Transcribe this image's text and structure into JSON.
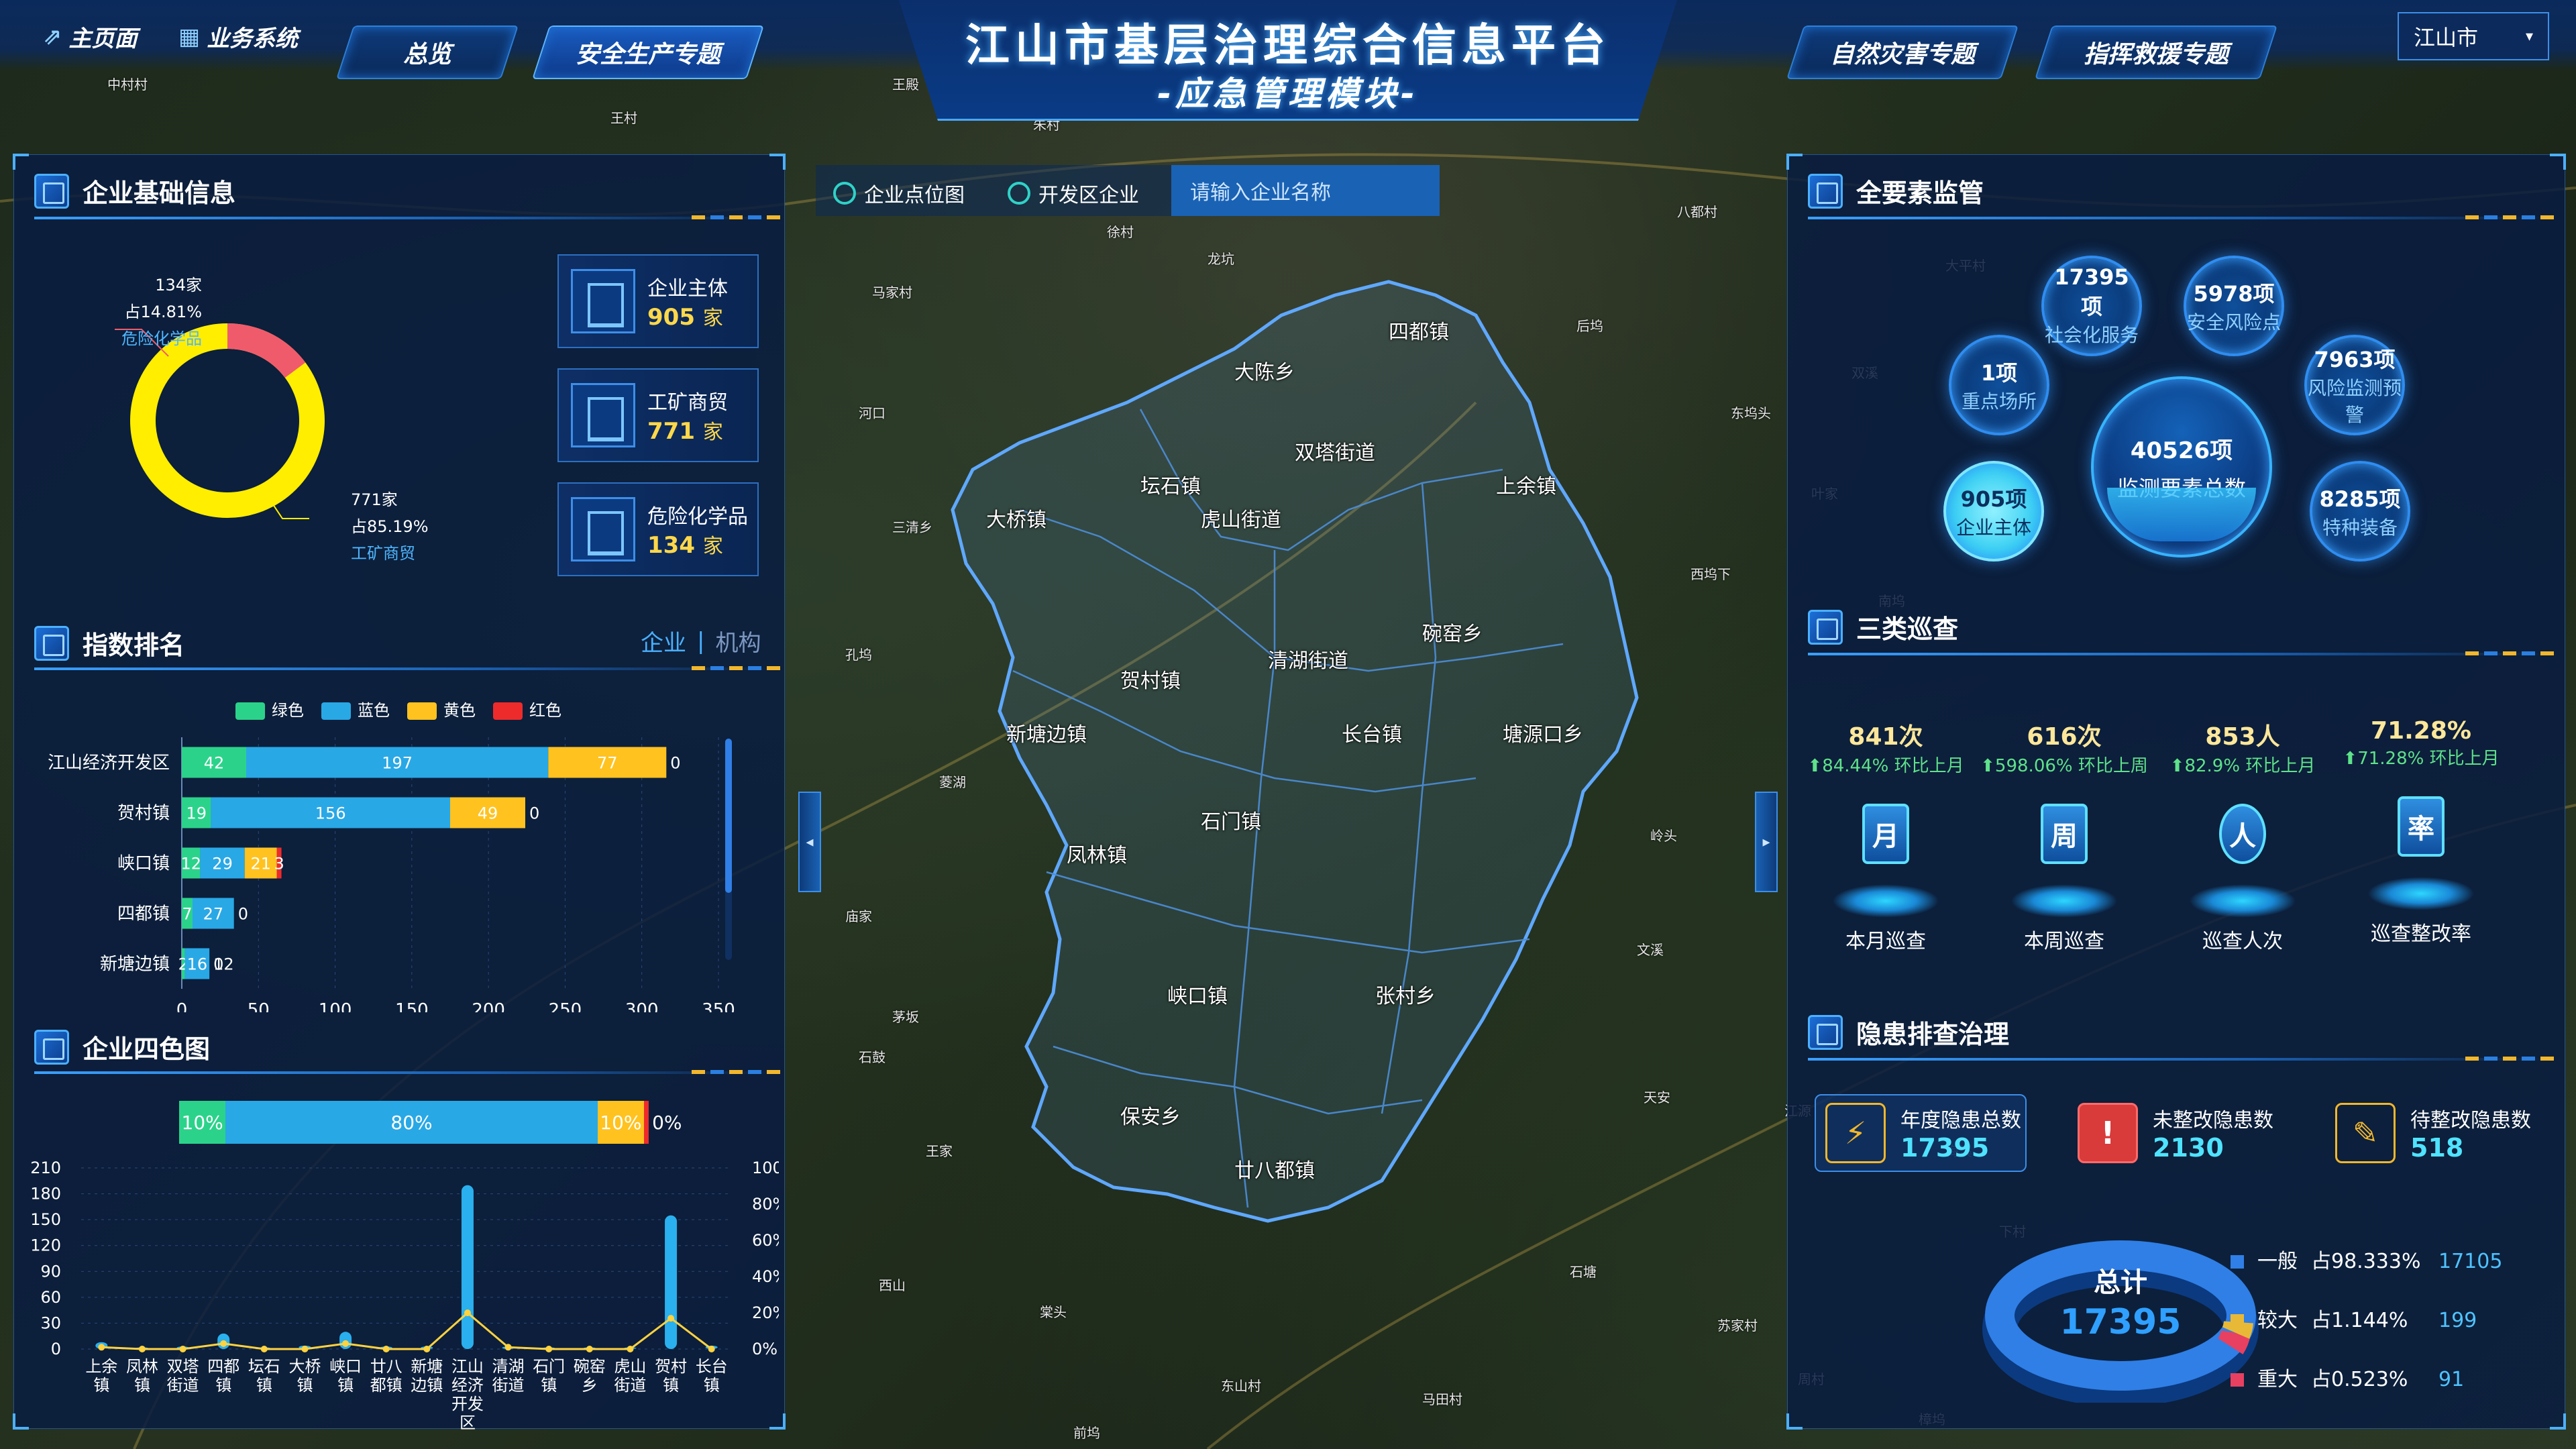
{
  "header": {
    "title": "江山市基层治理综合信息平台",
    "subtitle": "-应急管理模块-",
    "home_link": "主页面",
    "biz_link": "业务系统",
    "tabs": [
      "总览",
      "安全生产专题",
      "自然灾害专题",
      "指挥救援专题"
    ],
    "active_tab": "安全生产专题",
    "city_select": "江山市"
  },
  "map": {
    "toggle_point": "企业点位图",
    "toggle_zone": "开发区企业",
    "search_placeholder": "请输入企业名称",
    "townships": [
      "四都镇",
      "大陈乡",
      "双塔街道",
      "大桥镇",
      "坛石镇",
      "虎山街道",
      "上余镇",
      "碗窑乡",
      "贺村镇",
      "清湖街道",
      "新塘边镇",
      "长台镇",
      "塘源口乡",
      "凤林镇",
      "石门镇",
      "峡口镇",
      "张村乡",
      "保安乡",
      "廿八都镇"
    ],
    "villages": [
      "中村村",
      "王殿",
      "王村",
      "朱村",
      "龙坑",
      "马家村",
      "东坞头",
      "双溪",
      "八都村",
      "大平村",
      "三清乡",
      "孔坞",
      "西坞下",
      "南坞",
      "菱湖",
      "庙家",
      "王家",
      "天安",
      "石塘",
      "棠头",
      "苏家村",
      "东山村",
      "马田村",
      "周村",
      "西山",
      "石鼓",
      "文溪",
      "江源",
      "茅坂",
      "岭头",
      "梅溪",
      "下村",
      "前坞",
      "樟坞",
      "河口",
      "叶家",
      "徐村",
      "后坞"
    ]
  },
  "enterprise_info": {
    "title": "企业基础信息",
    "donut": [
      {
        "name": "危险化学品",
        "count": "134家",
        "pct": "占14.81%",
        "color": "#f05b6c"
      },
      {
        "name": "工矿商贸",
        "count": "771家",
        "pct": "占85.19%",
        "color": "#ffee00"
      }
    ],
    "cards": [
      {
        "label": "企业主体",
        "value": "905",
        "unit": "家"
      },
      {
        "label": "工矿商贸",
        "value": "771",
        "unit": "家"
      },
      {
        "label": "危险化学品",
        "value": "134",
        "unit": "家"
      }
    ]
  },
  "index_rank": {
    "title": "指数排名",
    "tab_enterprise": "企业",
    "tab_org": "机构",
    "legend": [
      {
        "name": "绿色",
        "color": "#2bd38a"
      },
      {
        "name": "蓝色",
        "color": "#29a8e6"
      },
      {
        "name": "黄色",
        "color": "#ffc21f"
      },
      {
        "name": "红色",
        "color": "#ee2b2b"
      }
    ]
  },
  "four_color": {
    "title": "企业四色图",
    "segments": [
      {
        "label": "10%",
        "pct": 10,
        "color": "#2bd38a"
      },
      {
        "label": "80%",
        "pct": 80,
        "color": "#29a8e6"
      },
      {
        "label": "10%",
        "pct": 10,
        "color": "#ffc21f"
      },
      {
        "label": "0%",
        "pct": 1,
        "color": "#ee2b2b"
      }
    ]
  },
  "chart_data": [
    {
      "type": "bar",
      "orientation": "horizontal",
      "stacked": true,
      "categories": [
        "江山经济开发区",
        "贺村镇",
        "峡口镇",
        "四都镇",
        "新塘边镇"
      ],
      "series": [
        {
          "name": "绿色",
          "values": [
            42,
            19,
            12,
            7,
            2
          ]
        },
        {
          "name": "蓝色",
          "values": [
            197,
            156,
            29,
            27,
            16
          ]
        },
        {
          "name": "黄色",
          "values": [
            77,
            49,
            21,
            0,
            0
          ]
        },
        {
          "name": "红色",
          "values": [
            0,
            0,
            3,
            0,
            0
          ]
        }
      ],
      "data_labels": [
        [
          "42",
          "197",
          "77",
          "0"
        ],
        [
          "19",
          "156",
          "49",
          "0"
        ],
        [
          "12",
          "29",
          "21",
          "3"
        ],
        [
          "7",
          "27",
          "0",
          ""
        ],
        [
          "2",
          "16",
          "12",
          "0"
        ]
      ],
      "xlim": [
        0,
        350
      ],
      "xticks": [
        0,
        50,
        100,
        150,
        200,
        250,
        300,
        350
      ]
    },
    {
      "type": "bar",
      "title": "",
      "categories": [
        "上余镇",
        "凤林镇",
        "双塔街道",
        "四都镇",
        "坛石镇",
        "大桥镇",
        "峡口镇",
        "廿八都镇",
        "新塘边镇",
        "江山经济开发区",
        "清湖街道",
        "石门镇",
        "碗窑乡",
        "虎山街道",
        "贺村镇",
        "长台镇"
      ],
      "series": [
        {
          "name": "数量",
          "type": "bar",
          "values": [
            8,
            2,
            3,
            18,
            2,
            4,
            20,
            3,
            3,
            190,
            3,
            2,
            2,
            2,
            155,
            4
          ]
        },
        {
          "name": "比例",
          "type": "line",
          "axis": "right",
          "values": [
            1,
            0,
            0,
            3,
            0,
            0,
            3,
            0,
            0,
            20,
            1,
            0,
            0,
            0,
            17,
            0
          ]
        }
      ],
      "ylim": [
        0,
        210
      ],
      "yticks": [
        0,
        30,
        60,
        90,
        120,
        150,
        180,
        210
      ],
      "y2lim": [
        0,
        100
      ],
      "y2ticks": [
        "0%",
        "20%",
        "40%",
        "60%",
        "80%",
        "100%"
      ]
    }
  ],
  "all_elements": {
    "title": "全要素监管",
    "center": {
      "value": "40526项",
      "label": "监测要素总数"
    },
    "bubbles": [
      {
        "value": "17395项",
        "label": "社会化服务"
      },
      {
        "value": "5978项",
        "label": "安全风险点"
      },
      {
        "value": "1项",
        "label": "重点场所"
      },
      {
        "value": "7963项",
        "label": "风险监测预警"
      },
      {
        "value": "905项",
        "label": "企业主体"
      },
      {
        "value": "8285项",
        "label": "特种装备"
      }
    ]
  },
  "inspection": {
    "title": "三类巡查",
    "items": [
      {
        "value": "841次",
        "delta": "84.44% 环比上月",
        "label": "本月巡查",
        "glyph": "月"
      },
      {
        "value": "616次",
        "delta": "598.06% 环比上周",
        "label": "本周巡查",
        "glyph": "周"
      },
      {
        "value": "853人",
        "delta": "82.9% 环比上月",
        "label": "巡查人次",
        "glyph": "人"
      },
      {
        "value": "71.28%",
        "delta": "71.28% 环比上月",
        "label": "巡查整改率",
        "glyph": "率"
      }
    ]
  },
  "hazard": {
    "title": "隐患排查治理",
    "cards": [
      {
        "label": "年度隐患总数",
        "value": "17395",
        "glyph": "⚡",
        "color": "#f2b72c"
      },
      {
        "label": "未整改隐患数",
        "value": "2130",
        "glyph": "!",
        "color": "#ff4d4d"
      },
      {
        "label": "待整改隐患数",
        "value": "518",
        "glyph": "✎",
        "color": "#f2b72c"
      }
    ],
    "total_label": "总计",
    "total_value": "17395",
    "levels": [
      {
        "name": "一般",
        "pct": "占98.333%",
        "count": "17105",
        "color": "#2f7fe6"
      },
      {
        "name": "较大",
        "pct": "占1.144%",
        "count": "199",
        "color": "#e8b936"
      },
      {
        "name": "重大",
        "pct": "占0.523%",
        "count": "91",
        "color": "#e84060"
      }
    ]
  }
}
